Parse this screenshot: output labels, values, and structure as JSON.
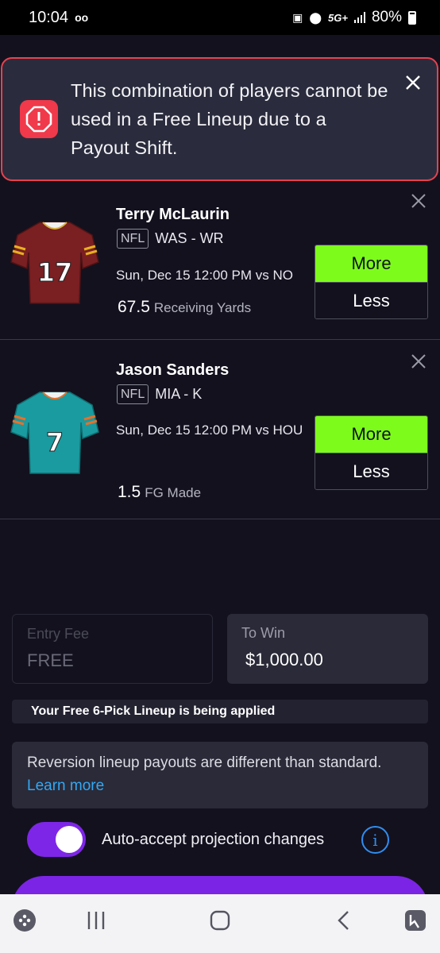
{
  "status_bar": {
    "time": "10:04",
    "network": "5G+",
    "battery": "80%"
  },
  "alert": {
    "message": "This combination of players cannot be used in a Free Lineup due to a Payout Shift.",
    "accent": "#e8414e"
  },
  "picks": [
    {
      "name": "Terry McLaurin",
      "league": "NFL",
      "team_pos": "WAS - WR",
      "game": "Sun, Dec 15 12:00 PM vs NO",
      "line": "67.5",
      "stat": "Receiving Yards",
      "jersey_number": "17",
      "jersey_color": "#7a1f22",
      "more_label": "More",
      "less_label": "Less"
    },
    {
      "name": "Jason Sanders",
      "league": "NFL",
      "team_pos": "MIA - K",
      "game": "Sun, Dec 15 12:00 PM vs HOU",
      "line": "1.5",
      "stat": "FG Made",
      "jersey_number": "7",
      "jersey_color": "#1a9ba0",
      "more_label": "More",
      "less_label": "Less"
    }
  ],
  "entry": {
    "entry_fee_label": "Entry Fee",
    "entry_fee_value": "FREE",
    "to_win_label": "To Win",
    "to_win_value": "$1,000.00"
  },
  "free_notice": "Your Free 6-Pick Lineup is being applied",
  "info_box": {
    "text": "Reversion lineup payouts are different than standard.",
    "link": "Learn more"
  },
  "auto_accept": {
    "label": "Auto-accept projection changes",
    "enabled": true
  },
  "colors": {
    "more_green": "#7dfc1c",
    "purple": "#7c24e6",
    "link_blue": "#33a8f4"
  }
}
